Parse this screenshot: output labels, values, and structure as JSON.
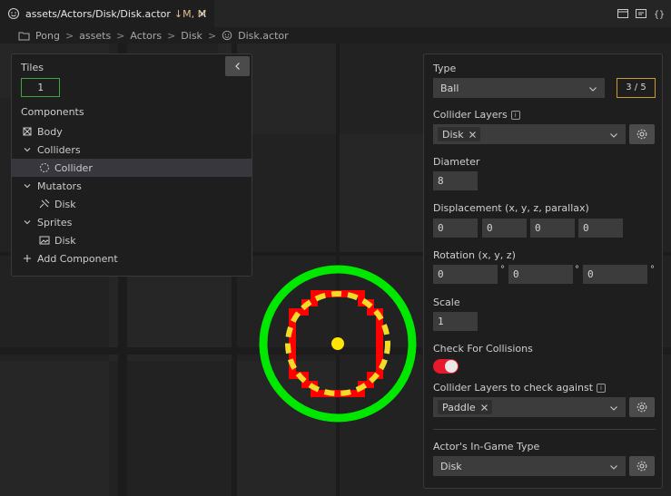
{
  "tab": {
    "title": "assets/Actors/Disk/Disk.actor",
    "status": "↓M, M",
    "modified_indicator": "M"
  },
  "breadcrumb": {
    "items": [
      "Pong",
      "assets",
      "Actors",
      "Disk",
      "Disk.actor"
    ],
    "separator": ">"
  },
  "left_panel": {
    "tiles_label": "Tiles",
    "tiles_value": "1",
    "components_label": "Components",
    "tree": [
      {
        "label": "Body",
        "icon": "body-icon"
      },
      {
        "label": "Colliders",
        "icon": "chevron-down-icon"
      },
      {
        "label": "Collider",
        "icon": "collider-circle-icon",
        "selected": true
      },
      {
        "label": "Mutators",
        "icon": "chevron-down-icon"
      },
      {
        "label": "Disk",
        "icon": "mutator-icon"
      },
      {
        "label": "Sprites",
        "icon": "chevron-down-icon"
      },
      {
        "label": "Disk",
        "icon": "image-icon"
      },
      {
        "label": "Add Component",
        "icon": "plus-icon"
      }
    ]
  },
  "inspector": {
    "type_label": "Type",
    "type_value": "Ball",
    "type_counter": "3 / 5",
    "collider_layers_label": "Collider Layers",
    "collider_layers_chip": "Disk",
    "diameter_label": "Diameter",
    "diameter_value": "8",
    "displacement_label": "Displacement (x, y, z, parallax)",
    "displacement_values": [
      "0",
      "0",
      "0",
      "0"
    ],
    "rotation_label": "Rotation (x, y, z)",
    "rotation_values": [
      "0",
      "0",
      "0"
    ],
    "degree_symbol": "°",
    "scale_label": "Scale",
    "scale_value": "1",
    "check_collisions_label": "Check For Collisions",
    "check_collisions_enabled": true,
    "check_against_label": "Collider Layers to check against",
    "check_against_chip": "Paddle",
    "ingame_type_label": "Actor's In-Game Type",
    "ingame_type_value": "Disk",
    "info_badge": "i"
  },
  "colors": {
    "outer_ring": "#00e800",
    "collider_dashes": "#f2dc2a",
    "sprite_red": "#ff0000",
    "center_dot": "#ffe600",
    "toggle_on": "#e8192c",
    "counter_border": "#c99a2e",
    "tiles_border": "#3fa63f"
  }
}
